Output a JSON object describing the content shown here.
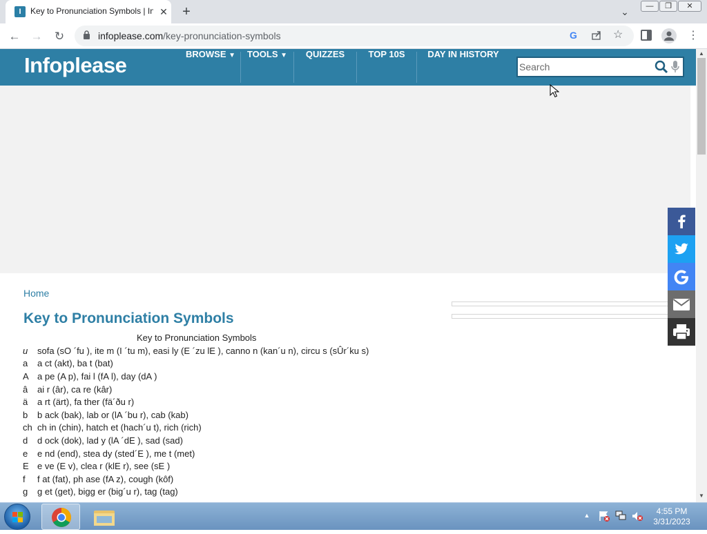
{
  "browser": {
    "tab_title": "Key to Pronunciation Symbols | Infoplease",
    "favicon_letter": "I",
    "url_host": "infoplease.com",
    "url_path": "/key-pronunciation-symbols"
  },
  "site": {
    "logo": "Infoplease",
    "nav": [
      "BROWSE",
      "TOOLS",
      "QUIZZES",
      "TOP 10S",
      "DAY IN HISTORY"
    ],
    "search_placeholder": "Search"
  },
  "content": {
    "breadcrumb": "Home",
    "title": "Key to Pronunciation Symbols",
    "table_caption": "Key to Pronunciation Symbols",
    "rows": [
      {
        "symbol": "u",
        "symbol_italic": true,
        "text": "sofa (sO ´fu ), ite m (I ´tu m), easi ly (E ´zu lE ), canno n (kan´u n), circu s (sÛr´ku s)"
      },
      {
        "symbol": "a",
        "symbol_italic": false,
        "text": "a ct (akt), ba t (bat)"
      },
      {
        "symbol": "A",
        "symbol_italic": false,
        "text": "a pe (A p), fai l (fA l), day (dA )"
      },
      {
        "symbol": "â",
        "symbol_italic": false,
        "text": "ai r (âr), ca re (kâr)"
      },
      {
        "symbol": "ä",
        "symbol_italic": false,
        "text": "a rt (ärt), fa ther (fä´ðu r)"
      },
      {
        "symbol": "b",
        "symbol_italic": false,
        "text": "b ack (bak), lab or (lA ´bu r), cab (kab)"
      },
      {
        "symbol": "ch",
        "symbol_italic": false,
        "text": "ch in (chin), hatch et (hach´u t), rich (rich)"
      },
      {
        "symbol": "d",
        "symbol_italic": false,
        "text": "d ock (dok), lad y (lA ´dE ), sad (sad)"
      },
      {
        "symbol": "e",
        "symbol_italic": false,
        "text": "e nd (end), stea dy (sted´E ), me t (met)"
      },
      {
        "symbol": "E",
        "symbol_italic": false,
        "text": "e ve (E v), clea r (klE r), see (sE )"
      },
      {
        "symbol": "f",
        "symbol_italic": false,
        "text": "f at (fat), ph ase (fA z), cough (kôf)"
      },
      {
        "symbol": "g",
        "symbol_italic": false,
        "text": "g et (get), bigg er (big´u r), tag (tag)"
      }
    ]
  },
  "taskbar": {
    "time": "4:55 PM",
    "date": "3/31/2023"
  },
  "colors": {
    "brand": "#2e7fa5",
    "facebook": "#3b5998",
    "twitter": "#1da1f2",
    "google": "#4285f4"
  }
}
